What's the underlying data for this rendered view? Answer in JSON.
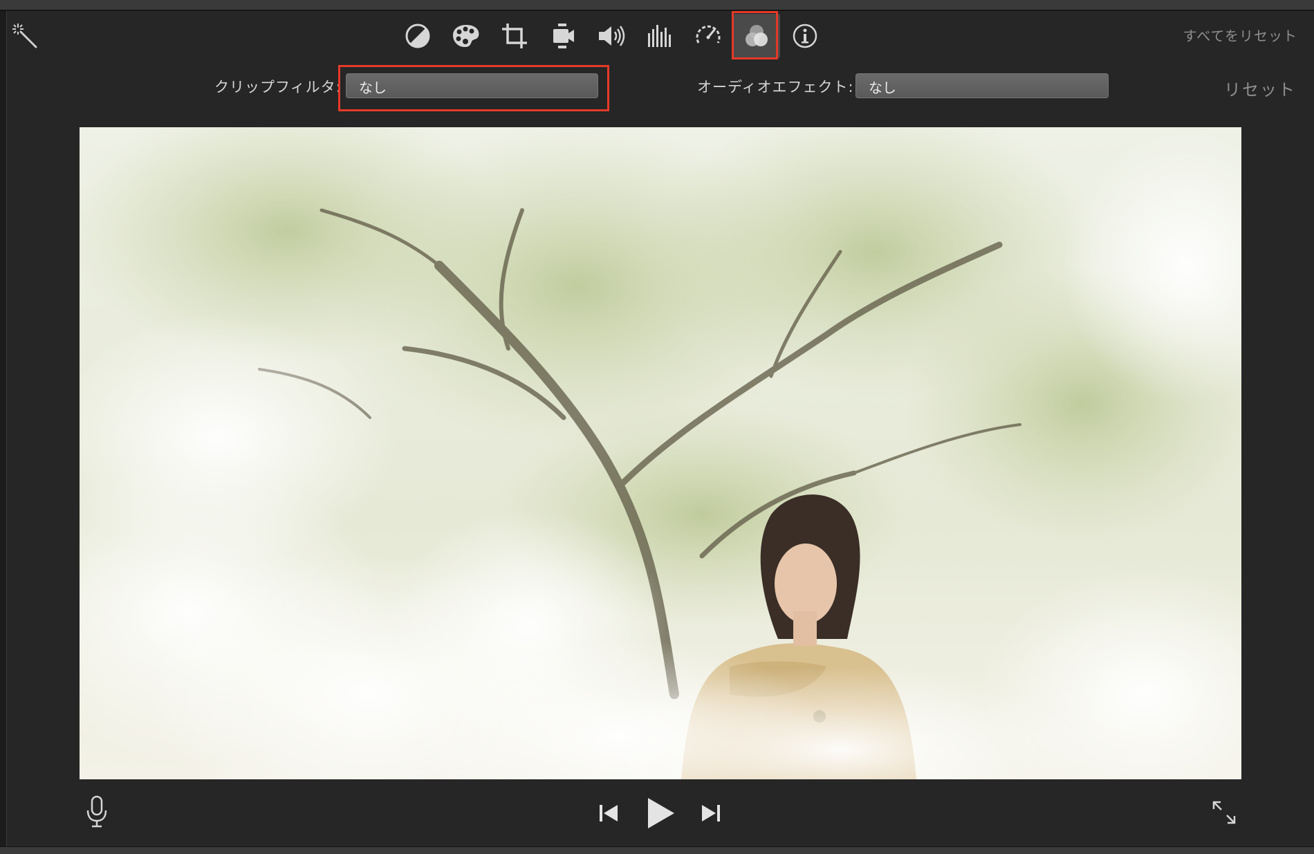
{
  "toolbar": {
    "tools": [
      {
        "icon": "color-balance-icon"
      },
      {
        "icon": "color-correction-icon"
      },
      {
        "icon": "crop-icon"
      },
      {
        "icon": "stabilization-icon"
      },
      {
        "icon": "volume-icon"
      },
      {
        "icon": "noise-reduction-equalizer-icon"
      },
      {
        "icon": "speed-icon"
      },
      {
        "icon": "clip-filter-icon",
        "active": true
      },
      {
        "icon": "clip-info-icon"
      }
    ],
    "reset_all_label": "すべてをリセット"
  },
  "filters": {
    "clip_filter_label": "クリップフィルタ:",
    "clip_filter_value": "なし",
    "audio_effect_label": "オーディオエフェクト:",
    "audio_effect_value": "なし",
    "reset_label": "リセット"
  },
  "colors": {
    "highlight": "#e53a28",
    "background": "#262626"
  }
}
